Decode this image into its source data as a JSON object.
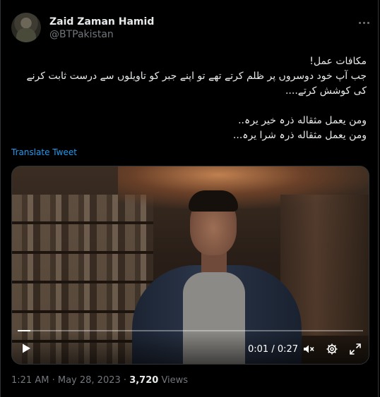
{
  "author": {
    "name": "Zaid Zaman Hamid",
    "handle": "@BTPakistan"
  },
  "tweet": {
    "lines": [
      "مکافات عمل!",
      "جب آپ خود دوسروں پر ظلم کرتے تھے تو اپنے جبر کو تاویلوں سے درست ثابت کرنے",
      "کی کوشش کرتے....",
      "",
      "ومن یعمل مثقاله ذرہ خیر یرہ..",
      "ومن یعمل مثقاله ذرہ شرا یرہ..."
    ],
    "translate_label": "Translate Tweet"
  },
  "video": {
    "current_time": "0:01",
    "duration": "0:27",
    "time_label": "0:01 / 0:27",
    "progress": 0.037
  },
  "meta": {
    "time": "1:21 AM",
    "date": "May 28, 2023",
    "separator": "·",
    "views_count": "3,720",
    "views_label": "Views"
  },
  "icons": {
    "more": "more-options-icon",
    "play": "play-icon",
    "mute": "volume-muted-icon",
    "settings": "settings-gear-icon",
    "fullscreen": "fullscreen-icon"
  },
  "colors": {
    "background": "#000000",
    "text": "#e7e9ea",
    "secondary": "#71767b",
    "link": "#1d9bf0",
    "border": "#2f3336"
  }
}
